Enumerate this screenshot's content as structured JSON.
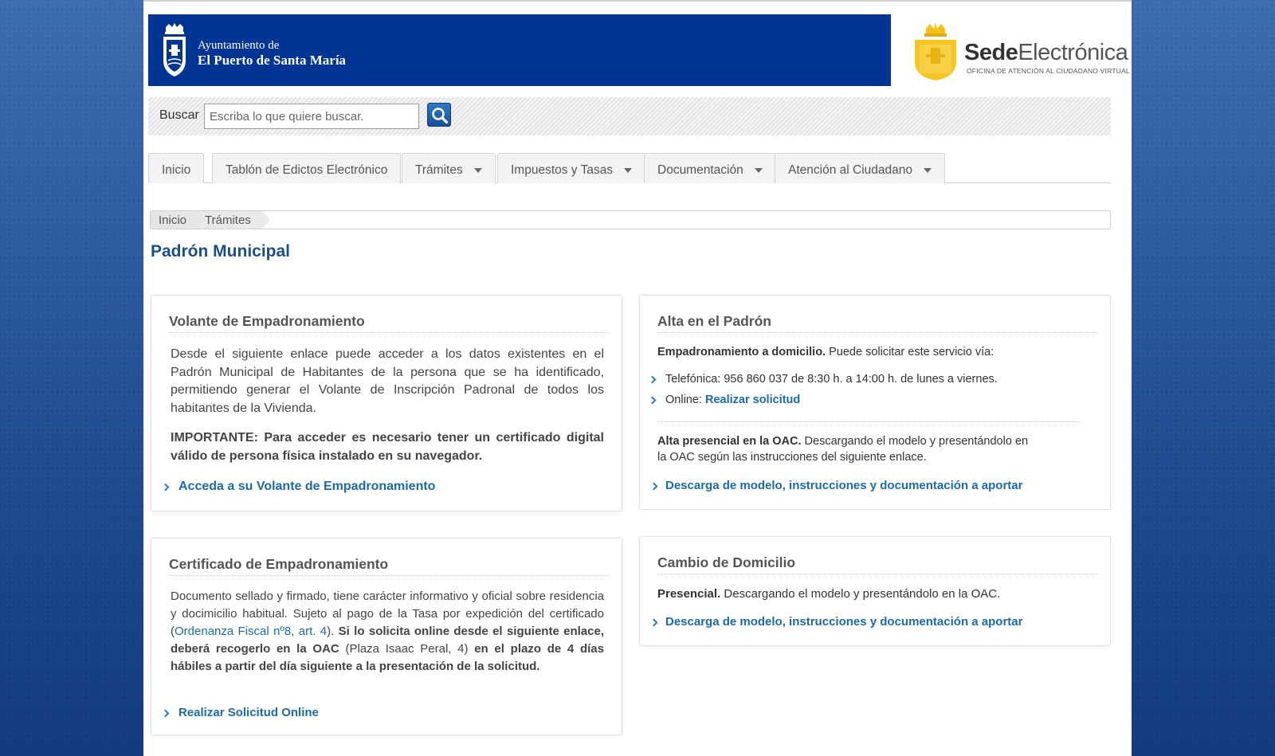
{
  "header": {
    "ayto_line1": "Ayuntamiento de",
    "ayto_line2": "El Puerto de Santa María",
    "sede_bold": "Sede",
    "sede_light": "Electrónica",
    "sede_subtitle": "OFICINA DE ATENCIÓN AL CIUDADANO VIRTUAL",
    "brand_color": "#003594",
    "sede_color": "#f3c11c"
  },
  "search": {
    "label": "Buscar",
    "placeholder": "Escriba lo que quiere buscar.",
    "button_icon": "search-icon"
  },
  "tabs": [
    {
      "label": "Inicio",
      "dropdown": false
    },
    {
      "label": "Tablón de Edictos Electrónico",
      "dropdown": false
    },
    {
      "label": "Trámites",
      "dropdown": true
    },
    {
      "label": "Impuestos y Tasas",
      "dropdown": true
    },
    {
      "label": "Documentación",
      "dropdown": true
    },
    {
      "label": "Atención al Ciudadano",
      "dropdown": true
    }
  ],
  "breadcrumb": [
    "Inicio",
    "Trámites"
  ],
  "page_title": "Padrón Municipal",
  "cards": {
    "volante": {
      "title": "Volante de Empadronamiento",
      "text": "Desde el siguiente enlace puede acceder a los datos existentes en el Padrón Municipal de Habitantes de la persona que se ha identificado, permitiendo generar el Volante de Inscripción Padronal de todos los habitantes de la Vivienda.",
      "important_label": "IMPORTANTE:",
      "important_text": "Para acceder es necesario tener un certificado digital válido de persona física instalado en su navegador.",
      "link": "Acceda a su Volante de Empadronamiento"
    },
    "alta": {
      "title": "Alta en el Padrón",
      "domicilio_bold": "Empadronamiento a domicilio.",
      "domicilio_text": "Puede solicitar este servicio vía:",
      "telefonica": "Telefónica: 956 860 037 de 8:30 h. a 14:00 h. de lunes a viernes.",
      "online_label": "Online:",
      "online_link": "Realizar solicitud",
      "presencial_bold": "Alta presencial en la OAC.",
      "presencial_text_1": "Descargando el modelo y presentándolo en",
      "presencial_text_2": "la OAC según las instrucciones del siguiente enlace.",
      "link": "Descarga de modelo, instrucciones y documentación a aportar"
    },
    "certificado": {
      "title": "Certificado de Empadronamiento",
      "text_1": "Documento sellado y firmado, tiene carácter informativo y oficial sobre residencia y docimicilio habitual. Sujeto al pago de la Tasa por expedición del certificado (",
      "ordenanza_link": "Ordenanza Fiscal nº8, art. 4",
      "text_2": ").",
      "bold_1": "Si lo solicita online desde el siguiente enlace, deberá recogerlo en la OAC",
      "plain_1": "(Plaza Isaac Peral, 4)",
      "bold_2": "en el plazo de 4 días hábiles a partir del día siguiente a la presentación de la solicitud.",
      "link": "Realizar Solicitud Online"
    },
    "cambio": {
      "title": "Cambio de Domicilio",
      "presencial_bold": "Presencial.",
      "presencial_text": "Descargando el modelo y presentándolo en la OAC.",
      "link": "Descarga de modelo, instrucciones y documentación a aportar"
    }
  }
}
